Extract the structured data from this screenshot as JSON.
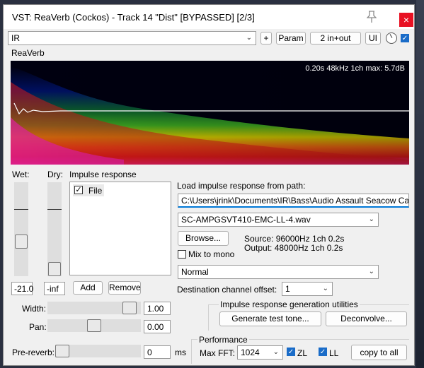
{
  "window": {
    "title": "VST: ReaVerb (Cockos) - Track 14 \"Dist\" [BYPASSED] [2/3]",
    "pin_icon": "pin-icon",
    "close_glyph": "×"
  },
  "toolbar": {
    "preset_value": "IR",
    "plus_label": "+",
    "param_label": "Param",
    "io_label": "2 in+out",
    "ui_label": "UI"
  },
  "plugin_label": "ReaVerb",
  "spectrogram": {
    "info": "0.20s 48kHz 1ch max: 5.7dB"
  },
  "wet": {
    "label": "Wet:",
    "value": "-21.0"
  },
  "dry": {
    "label": "Dry:",
    "value": "-inf"
  },
  "impulse": {
    "label": "Impulse response",
    "items": [
      {
        "label": "File",
        "checked": true
      }
    ],
    "add_label": "Add",
    "remove_label": "Remove"
  },
  "load": {
    "label": "Load impulse response from path:",
    "path": "C:\\Users\\jrink\\Documents\\IR\\Bass\\Audio Assault Seacow Cabs Amp",
    "file": "SC-AMPGSVT410-EMC-LL-4.wav",
    "browse_label": "Browse...",
    "source": "Source: 96000Hz 1ch 0.2s",
    "output": "Output: 48000Hz 1ch 0.2s",
    "mono_label": "Mix to mono",
    "mode": "Normal",
    "dest_label": "Destination channel offset:",
    "dest_value": "1"
  },
  "width": {
    "label": "Width:",
    "value": "1.00",
    "level": 0.95
  },
  "pan": {
    "label": "Pan:",
    "value": "0.00",
    "level": 0.5
  },
  "prereverb": {
    "label": "Pre-reverb:",
    "value": "0",
    "unit": "ms",
    "level": 0.0
  },
  "gen": {
    "label": "Impulse response generation utilities",
    "tone_label": "Generate test tone...",
    "deconv_label": "Deconvolve..."
  },
  "perf": {
    "label": "Performance",
    "fft_label": "Max FFT:",
    "fft_value": "1024",
    "zl_label": "ZL",
    "ll_label": "LL",
    "copy_label": "copy to all"
  },
  "colors": {
    "close": "#e81123",
    "check_blue": "#1a6cc8",
    "accent_border": "#0078d7"
  }
}
